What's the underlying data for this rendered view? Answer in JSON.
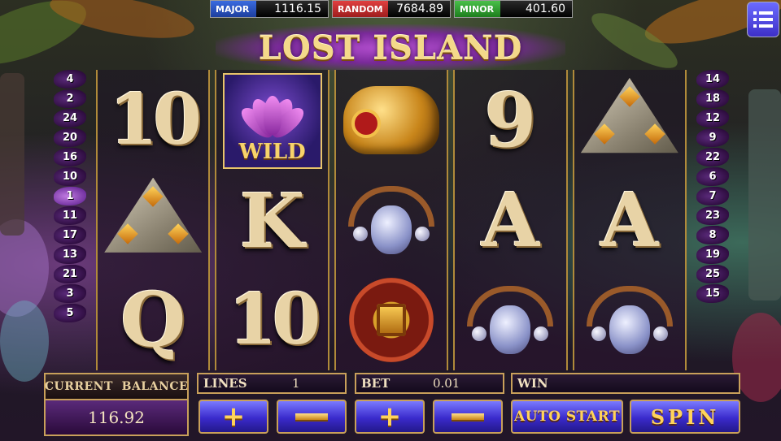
{
  "jackpots": [
    {
      "label": "MAJOR",
      "value": "1116.15"
    },
    {
      "label": "RANDOM",
      "value": "7684.89"
    },
    {
      "label": "MINOR",
      "value": "401.60"
    }
  ],
  "title": "LOST ISLAND",
  "menu_icon": "hamburger-menu-icon",
  "left_lines": [
    "4",
    "2",
    "24",
    "20",
    "16",
    "10",
    "1",
    "11",
    "17",
    "13",
    "21",
    "3",
    "5"
  ],
  "right_lines": [
    "14",
    "18",
    "12",
    "9",
    "22",
    "6",
    "7",
    "23",
    "8",
    "19",
    "25",
    "15"
  ],
  "active_line": "1",
  "reels": [
    [
      "10",
      "stone-triangle",
      "Q"
    ],
    [
      "wild-lotus",
      "K",
      "10"
    ],
    [
      "golden-shell",
      "amulet-necklace",
      "gold-medallion"
    ],
    [
      "9",
      "A",
      "amulet-necklace"
    ],
    [
      "stone-triangle",
      "A",
      "amulet-necklace"
    ]
  ],
  "wild_label": "WILD",
  "balance": {
    "label": "CURRENT  BALANCE",
    "value": "116.92"
  },
  "lines": {
    "label": "LINES",
    "value": "1"
  },
  "bet": {
    "label": "BET",
    "value": "0.01"
  },
  "win": {
    "label": "WIN",
    "value": ""
  },
  "buttons": {
    "lines_plus": "+",
    "bet_plus": "+",
    "auto_start": "AUTO START",
    "spin": "SPIN"
  }
}
